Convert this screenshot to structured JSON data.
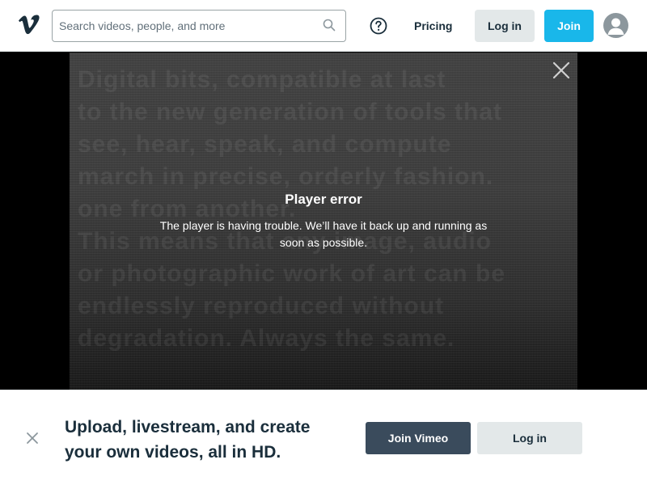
{
  "header": {
    "search": {
      "placeholder": "Search videos, people, and more",
      "value": ""
    },
    "pricing_label": "Pricing",
    "login_label": "Log in",
    "join_label": "Join",
    "icons": {
      "logo": "vimeo-logo-icon",
      "search": "search-icon",
      "help": "help-circle-icon",
      "avatar": "user-avatar-icon"
    },
    "colors": {
      "join_bg": "#19b7ea",
      "login_bg": "#e3e8e9",
      "text": "#1a2e3b"
    }
  },
  "player": {
    "error_title": "Player error",
    "error_message": "The player is having trouble. We’ll have it back up and running as soon as possible.",
    "background_text": [
      "Digital bits, compatible at last",
      "to the new generation of tools that",
      "see, hear, speak, and compute",
      "march in precise, orderly fashion.",
      "one from another.",
      "This means that any image, audio",
      "or photographic work of art can be",
      "endlessly reproduced without",
      "degradation. Always the same."
    ],
    "icons": {
      "close": "close-icon"
    }
  },
  "banner": {
    "text": "Upload, livestream, and create your own videos, all in HD.",
    "join_label": "Join Vimeo",
    "login_label": "Log in",
    "icons": {
      "close": "close-icon"
    },
    "colors": {
      "join_bg": "#3a4b5c",
      "login_bg": "#e3e8e9"
    }
  }
}
